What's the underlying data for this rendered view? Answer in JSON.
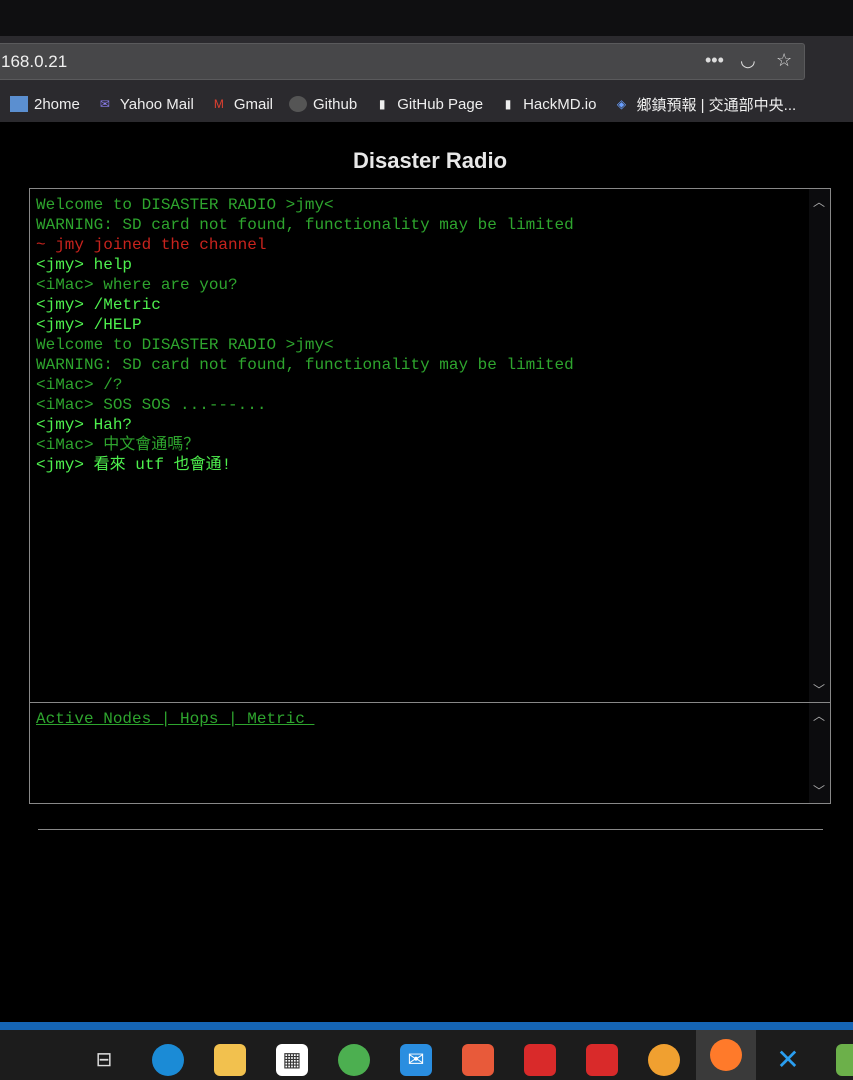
{
  "browser": {
    "url": "168.0.21",
    "bookmarks": [
      {
        "label": "2home",
        "icon": "2home-icon"
      },
      {
        "label": "Yahoo Mail",
        "icon": "mail-icon"
      },
      {
        "label": "Gmail",
        "icon": "gmail-icon"
      },
      {
        "label": "Github",
        "icon": "github-icon"
      },
      {
        "label": "GitHub Page",
        "icon": "document-icon"
      },
      {
        "label": "HackMD.io",
        "icon": "document-icon"
      },
      {
        "label": "鄉鎮預報 | 交通部中央...",
        "icon": "weather-icon"
      }
    ]
  },
  "page": {
    "title": "Disaster Radio",
    "messages": [
      {
        "text": "Welcome to DISASTER RADIO >jmy<",
        "style": "dim"
      },
      {
        "text": "WARNING: SD card not found, functionality may be limited",
        "style": "dim"
      },
      {
        "text": "~ jmy joined the channel",
        "style": "red"
      },
      {
        "text": "<jmy> help",
        "style": "bright"
      },
      {
        "text": "<iMac> where are you?",
        "style": "dim"
      },
      {
        "text": "<jmy> /Metric",
        "style": "bright"
      },
      {
        "text": "<jmy> /HELP",
        "style": "bright"
      },
      {
        "text": "Welcome to DISASTER RADIO >jmy<",
        "style": "dim"
      },
      {
        "text": "WARNING: SD card not found, functionality may be limited",
        "style": "dim"
      },
      {
        "text": "<iMac> /?",
        "style": "dim"
      },
      {
        "text": "<iMac> SOS SOS ...---...",
        "style": "dim"
      },
      {
        "text": "<jmy> Hah?",
        "style": "bright"
      },
      {
        "text": "<iMac> 中文會通嗎？",
        "style": "dim"
      },
      {
        "text": "<jmy> 看來 utf 也會通!",
        "style": "bright"
      }
    ],
    "nodes_header": "Active Nodes | Hops | Metric "
  },
  "colors": {
    "bright": "#4ef04e",
    "dim": "#2ea52e",
    "red": "#c8231d",
    "taskbar_accent": "#1565b5"
  }
}
